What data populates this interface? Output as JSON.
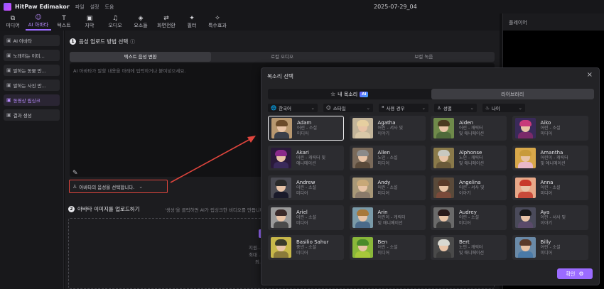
{
  "app": {
    "name": "HitPaw Edimakor",
    "menu": [
      "파일",
      "설정",
      "도움"
    ],
    "window_title": "2025-07-29_04"
  },
  "toolbar": [
    {
      "label": "미디어",
      "icon": "media-icon"
    },
    {
      "label": "AI 아바타",
      "icon": "ai-avatar-icon",
      "active": true
    },
    {
      "label": "텍스트",
      "icon": "text-icon"
    },
    {
      "label": "자막",
      "icon": "subtitle-icon"
    },
    {
      "label": "오디오",
      "icon": "audio-icon"
    },
    {
      "label": "요소들",
      "icon": "elements-icon"
    },
    {
      "label": "화면전환",
      "icon": "transition-icon"
    },
    {
      "label": "필터",
      "icon": "filter-icon"
    },
    {
      "label": "특수효과",
      "icon": "effects-icon"
    }
  ],
  "preview": {
    "title": "플레이어"
  },
  "sidebar": {
    "items": [
      {
        "label": "AI 아바타"
      },
      {
        "label": "노래하는 이미..."
      },
      {
        "label": "말하는 동물 만..."
      },
      {
        "label": "말하는 사진 만..."
      },
      {
        "label": "동영상 립싱크",
        "active": true
      },
      {
        "label": "결과 생성"
      }
    ]
  },
  "step1": {
    "num": "1",
    "title": "음성 업로드 방법 선택",
    "tabs": [
      "텍스트 음성 변환",
      "로컬 오디오",
      "보컬 녹음"
    ],
    "placeholder": "AI 아바타가 말할 내용을 아래에 입력하거나 붙여넣으세요.",
    "voice_select": "아바타의 음성을 선택합니다."
  },
  "step2": {
    "num": "2",
    "title": "아바타 이미지를 업로드하기",
    "desc": "'생성'을 클릭하면 AI가 립싱크한 비디오를 만듭니다.",
    "hint_lines": [
      "지원...",
      "최대 ...",
      "최..."
    ]
  },
  "dialog": {
    "title": "목소리 선택",
    "tabs": {
      "mine": "내 목소리",
      "ai_badge": "AI",
      "library": "라이브러리"
    },
    "filters": [
      {
        "label": "한국어",
        "icon": "globe-icon"
      },
      {
        "label": "스타일",
        "icon": "smile-icon"
      },
      {
        "label": "사용 경우",
        "icon": "quote-icon"
      },
      {
        "label": "성별",
        "icon": "person-icon"
      },
      {
        "label": "나이",
        "icon": "cake-icon"
      }
    ],
    "voices": [
      {
        "name": "Adam",
        "tags": "어린 - 소설\n미디어",
        "selected": true,
        "hair": "#6a4a2a",
        "body": "#3a3f4a",
        "bg": "#b89870"
      },
      {
        "name": "Agatha",
        "tags": "어린 - 서사 및\n이야기",
        "hair": "#e6cfa0",
        "body": "#d9c8a8",
        "bg": "#c2b49a"
      },
      {
        "name": "Aiden",
        "tags": "어린 - 캐릭터\n및 애니메이션",
        "hair": "#4a3a20",
        "body": "#4f6a3a",
        "bg": "#6f8a4a"
      },
      {
        "name": "Aiko",
        "tags": "어린 - 소설\n미디어",
        "hair": "#c83a7a",
        "body": "#7a2a6a",
        "bg": "#3a2a5a"
      },
      {
        "name": "Akari",
        "tags": "어린 - 캐릭터 및\n애니메이션",
        "hair": "#8a2a8a",
        "body": "#3a2a5a",
        "bg": "#2a1a3a"
      },
      {
        "name": "Allen",
        "tags": "노인 - 소설\n미디어",
        "hair": "#8a8a8a",
        "body": "#5a4a3a",
        "bg": "#7a6a5a"
      },
      {
        "name": "Alphonse",
        "tags": "노인 - 캐릭터\n및 애니메이션",
        "hair": "#c8c8c0",
        "body": "#6a5a3a",
        "bg": "#8a7a4a"
      },
      {
        "name": "Amantha",
        "tags": "어린이 - 캐릭터\n및 애니메이션",
        "hair": "#c89a3a",
        "body": "#e8b8c8",
        "bg": "#d8a84a"
      },
      {
        "name": "Andrew",
        "tags": "어린 - 소설\n미디어",
        "hair": "#2a2a2a",
        "body": "#1a1a2a",
        "bg": "#4a4a52"
      },
      {
        "name": "Andy",
        "tags": "어린 - 소설\n미디어",
        "hair": "#c8a878",
        "body": "#8a7a6a",
        "bg": "#a89878"
      },
      {
        "name": "Angelina",
        "tags": "어린 - 서사 및\n이야기",
        "hair": "#5a3a2a",
        "body": "#7a4a3a",
        "bg": "#5a4a3a"
      },
      {
        "name": "Anna",
        "tags": "어린 - 소설\n미디어",
        "hair": "#c83a2a",
        "body": "#c84a3a",
        "bg": "#e8a888"
      },
      {
        "name": "Ariel",
        "tags": "어린 - 소설\n미디어",
        "hair": "#3a2a2a",
        "body": "#4a4a4a",
        "bg": "#9a9a9a"
      },
      {
        "name": "Arin",
        "tags": "어린이 - 캐릭터\n및 애니메이션",
        "hair": "#a8783a",
        "body": "#4a6a8a",
        "bg": "#7a9aa8"
      },
      {
        "name": "Audrey",
        "tags": "어린 - 소설\n미디어",
        "hair": "#2a1a1a",
        "body": "#3a3a3a",
        "bg": "#6a6a6a"
      },
      {
        "name": "Aya",
        "tags": "어린 - 서사 및\n이야기",
        "hair": "#1a1a1a",
        "body": "#5a4a6a",
        "bg": "#4a4a5a"
      },
      {
        "name": "Basilio Sahur",
        "tags": "중년 - 소설\n미디어",
        "hair": "#3a3a2a",
        "body": "#8a7a3a",
        "bg": "#c8b84a"
      },
      {
        "name": "Ben",
        "tags": "어린 - 소설\n미디어",
        "hair": "#4a8a2a",
        "body": "#a8c83a",
        "bg": "#8ab83a"
      },
      {
        "name": "Bert",
        "tags": "노인 - 캐릭터\n및 애니메이션",
        "hair": "#d8d8d0",
        "body": "#3a3a3a",
        "bg": "#4a4a4a"
      },
      {
        "name": "Billy",
        "tags": "어린 - 소설\n미디어",
        "hair": "#5a3a2a",
        "body": "#4a7aa8",
        "bg": "#6a8aa8"
      }
    ],
    "confirm": "확인"
  },
  "colors": {
    "accent": "#9b6bff",
    "highlight": "#e0453d"
  }
}
